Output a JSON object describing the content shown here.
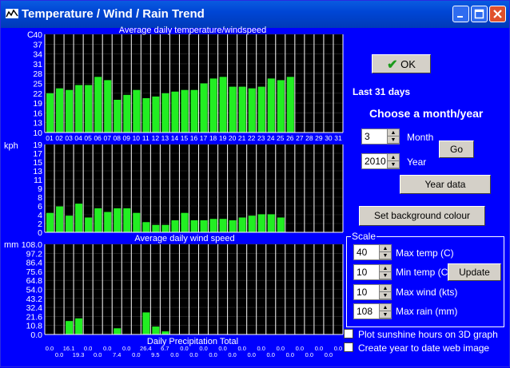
{
  "window": {
    "title": "Temperature / Wind / Rain Trend",
    "buttons": [
      "minimize",
      "maximize",
      "close"
    ]
  },
  "colors": {
    "background": "#0000fe",
    "bar": "#22ee22",
    "plot_bg": "#000000",
    "grid": "#ffffff"
  },
  "side": {
    "ok_label": "OK",
    "last_days": "Last 31 days",
    "choose_label": "Choose a month/year",
    "month_label": "Month",
    "month_value": "3",
    "year_label": "Year",
    "year_value": "2010",
    "go_label": "Go",
    "year_data_label": "Year data",
    "set_bg_label": "Set background colour",
    "scale": {
      "legend": "Scale",
      "max_temp_label": "Max temp (C)",
      "max_temp_value": "40",
      "min_temp_label": "Min temp (C)",
      "min_temp_value": "10",
      "max_wind_label": "Max wind (kts)",
      "max_wind_value": "10",
      "max_rain_label": "Max rain (mm)",
      "max_rain_value": "108",
      "update_label": "Update"
    },
    "plot_sunshine_label": "Plot sunshine hours on 3D graph",
    "create_image_label": "Create year to date web image"
  },
  "chart_data": [
    {
      "type": "bar",
      "title": "Average daily temperature/windspeed",
      "ylabel": "C",
      "ylim": [
        10,
        40
      ],
      "yticks": [
        "40",
        "37",
        "34",
        "31",
        "28",
        "25",
        "22",
        "19",
        "16",
        "13",
        "10"
      ],
      "categories": [
        "01",
        "02",
        "03",
        "04",
        "05",
        "06",
        "07",
        "08",
        "09",
        "10",
        "11",
        "12",
        "13",
        "14",
        "15",
        "16",
        "17",
        "18",
        "19",
        "20",
        "21",
        "22",
        "23",
        "24",
        "25",
        "26",
        "27",
        "28",
        "29",
        "30",
        "31"
      ],
      "values": [
        22,
        23.5,
        23,
        24.5,
        24.5,
        27,
        26,
        20,
        21.5,
        23,
        20.5,
        21,
        22,
        22.5,
        23,
        23,
        25,
        26.5,
        27,
        24,
        24,
        23.5,
        24,
        26.5,
        26,
        27,
        null,
        null,
        null,
        null,
        null
      ]
    },
    {
      "type": "bar",
      "title": "Average daily wind speed",
      "ylabel": "kph",
      "ylim": [
        0,
        19
      ],
      "yticks": [
        "19",
        "17",
        "15",
        "13",
        "11",
        "9",
        "8",
        "6",
        "4",
        "2",
        "0"
      ],
      "values": [
        4.2,
        5.6,
        3.6,
        6.2,
        3.2,
        5.2,
        4.4,
        5.2,
        5.2,
        4.2,
        2.2,
        1.6,
        1.6,
        2.6,
        4.2,
        2.6,
        2.6,
        2.9,
        2.9,
        2.6,
        3.2,
        3.6,
        3.9,
        3.9,
        3.2,
        null,
        null,
        null,
        null,
        null,
        null
      ]
    },
    {
      "type": "bar",
      "title": "Daily Precipitation Total",
      "ylabel": "mm",
      "ylim": [
        0,
        108
      ],
      "yticks": [
        "108.0",
        "97.2",
        "86.4",
        "75.6",
        "64.8",
        "54.0",
        "43.2",
        "32.4",
        "21.6",
        "10.8",
        "0.0"
      ],
      "values": [
        0,
        0,
        16.1,
        19.3,
        0,
        0,
        0,
        7.4,
        0,
        0,
        26.4,
        9.5,
        3.7,
        0,
        0,
        0,
        0,
        0,
        0,
        0,
        0,
        0,
        0,
        0,
        0,
        0,
        0,
        0,
        0,
        0,
        0
      ],
      "data_labels": [
        "0.0",
        "0.0",
        "16.1",
        "19.3",
        "0.0",
        "0.0",
        "0.0",
        "7.4",
        "0.0",
        "0.0",
        "26.4",
        "9.5",
        "6.7",
        "0.0",
        "0.0",
        "0.0",
        "0.0",
        "0.0",
        "0.0",
        "0.0",
        "0.0",
        "0.0",
        "0.0",
        "0.0",
        "0.0",
        "0.0",
        "0.0",
        "0.0",
        "0.0",
        "0.0",
        "0.0"
      ]
    }
  ]
}
